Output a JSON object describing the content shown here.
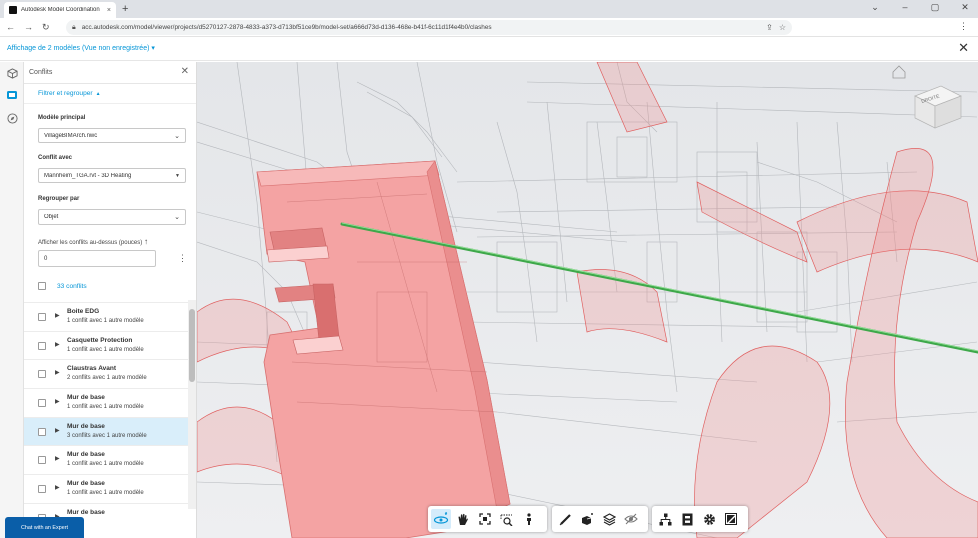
{
  "browser": {
    "tab_title": "Autodesk Model Coordination",
    "tab_close": "×",
    "new_tab": "+",
    "url": "acc.autodesk.com/model/viewer/projects/d5270127-2878-4833-a373-d713bf51ce9b/model-set/a666d73d-d136-468e-b41f-6c11d1f4e4b0/clashes",
    "win_minimize": "⌄",
    "win_min": "–",
    "win_max": "▢",
    "win_close": "✕"
  },
  "app": {
    "view_title": "Affichage de 2 modèles (Vue non enregistrée) ▾",
    "close": "✕"
  },
  "panel": {
    "title": "Conflits",
    "close": "✕",
    "filter_group_label": "Filtrer et regrouper",
    "main_model_label": "Modèle principal",
    "main_model_value": "VillageBIMArch.nwc",
    "conflict_with_label": "Conflit avec",
    "conflict_with_value": "Mannheim_TGA.rvt - 3D Heating",
    "group_by_label": "Regrouper par",
    "group_by_value": "Objet",
    "show_above_label": "Afficher les conflits au-dessus (pouces)",
    "show_above_value": "0",
    "select_all_label": "33 conflits",
    "chat_button": "Chat with an Expert",
    "conflicts": [
      {
        "name": "Boite EDG",
        "detail": "1 conflit avec 1 autre modèle",
        "selected": false
      },
      {
        "name": "Casquette Protection",
        "detail": "1 conflit avec 1 autre modèle",
        "selected": false
      },
      {
        "name": "Claustras Avant",
        "detail": "2 conflits avec 1 autre modèle",
        "selected": false
      },
      {
        "name": "Mur de base",
        "detail": "1 conflit avec 1 autre modèle",
        "selected": false
      },
      {
        "name": "Mur de base",
        "detail": "3 conflits avec 1 autre modèle",
        "selected": true
      },
      {
        "name": "Mur de base",
        "detail": "1 conflit avec 1 autre modèle",
        "selected": false
      },
      {
        "name": "Mur de base",
        "detail": "1 conflit avec 1 autre modèle",
        "selected": false
      },
      {
        "name": "Mur de base",
        "detail": "",
        "selected": false
      }
    ]
  },
  "viewcube": {
    "label": "DROITE"
  },
  "toolbar_groups": [
    [
      "orbit-icon",
      "pan-icon",
      "fit-view-icon",
      "zoom-window-icon",
      "first-person-icon"
    ],
    [
      "measure-icon",
      "section-icon",
      "explode-icon",
      "hide-icon"
    ],
    [
      "model-browser-icon",
      "properties-icon",
      "settings-icon",
      "fullscreen-icon"
    ]
  ],
  "colors": {
    "accent": "#0696d7",
    "clash_red": "#f08080",
    "pipe_green": "#54c25a",
    "selected_row": "#d9eefa"
  }
}
